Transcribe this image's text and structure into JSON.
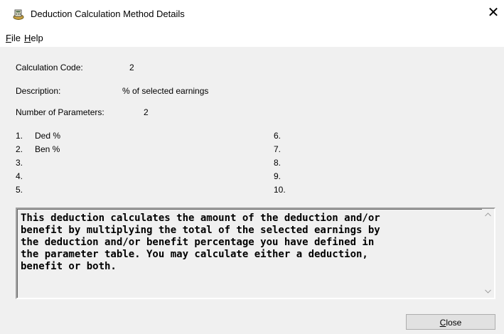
{
  "window": {
    "title": "Deduction Calculation Method Details",
    "close_glyph": "✕"
  },
  "menu": {
    "items": [
      {
        "accel": "F",
        "rest": "ile"
      },
      {
        "accel": "H",
        "rest": "elp"
      }
    ]
  },
  "fields": {
    "calc_code_label": "Calculation Code:",
    "calc_code_value": "2",
    "description_label": "Description:",
    "description_value": "% of selected earnings",
    "num_params_label": "Number of Parameters:",
    "num_params_value": "2"
  },
  "parameters": [
    {
      "num": "1.",
      "name": "Ded %"
    },
    {
      "num": "2.",
      "name": "Ben %"
    },
    {
      "num": "3.",
      "name": ""
    },
    {
      "num": "4.",
      "name": ""
    },
    {
      "num": "5.",
      "name": ""
    },
    {
      "num": "6.",
      "name": ""
    },
    {
      "num": "7.",
      "name": ""
    },
    {
      "num": "8.",
      "name": ""
    },
    {
      "num": "9.",
      "name": ""
    },
    {
      "num": "10.",
      "name": ""
    }
  ],
  "memo": {
    "text": "This deduction calculates the amount of the deduction and/or\nbenefit by multiplying the total of the selected earnings by\nthe deduction and/or benefit percentage you have defined in\nthe parameter table. You may calculate either a deduction,\nbenefit or both."
  },
  "buttons": {
    "close_accel": "C",
    "close_rest": "lose"
  },
  "icons": {
    "app_icon": "calculator-money-icon",
    "scroll_up": "chevron-up-icon",
    "scroll_down": "chevron-down-icon"
  }
}
